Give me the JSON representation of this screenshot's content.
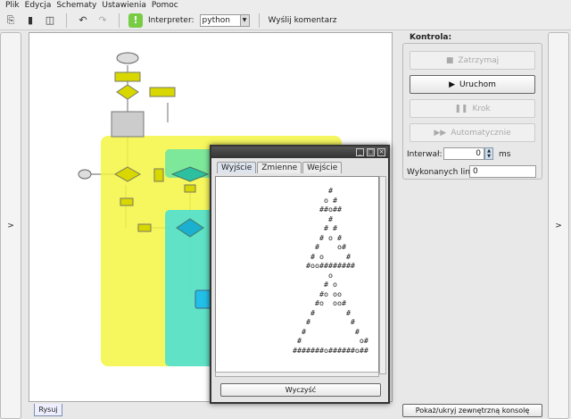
{
  "menu": [
    "Plik",
    "Edycja",
    "Schematy",
    "Ustawienia",
    "Pomoc"
  ],
  "toolbar": {
    "interpreter_label": "Interpreter:",
    "interpreter_value": "python",
    "send_comment": "Wyślij komentarz"
  },
  "side_left": ">",
  "side_right": ">",
  "canvas_tab": "Rysuj",
  "control": {
    "title": "Kontrola:",
    "stop": "Zatrzymaj",
    "run": "Uruchom",
    "step": "Krok",
    "auto": "Automatycznie",
    "interval_label": "Interwał:",
    "interval_value": "0",
    "interval_unit": "ms",
    "lines_label": "Wykonanych linii:",
    "lines_value": "0",
    "console_toggle": "Pokaż/ukryj zewnętrzną konsolę"
  },
  "console": {
    "tabs": [
      "Wyjście",
      "Zmienne",
      "Wejście"
    ],
    "active_tab": "Wyjście",
    "clear": "Wyczyść",
    "output": [
      "        #",
      "       o #",
      "      ##o##",
      "        #",
      "       # #",
      "      # o #",
      "     #    o#",
      "    # o     #",
      "   #oo########",
      "        o",
      "       # o",
      "      #o oo",
      "     #o  oo#",
      "    #       #",
      "   #         #",
      "  #           #",
      " #             o#",
      "#######o######o##"
    ]
  },
  "colors": {
    "yellow_block": "#f5f542",
    "green_block": "#7ee89a",
    "cyan_block": "#4fe0d0",
    "node_yellow": "#d8d800",
    "node_teal": "#2cc0a0"
  }
}
